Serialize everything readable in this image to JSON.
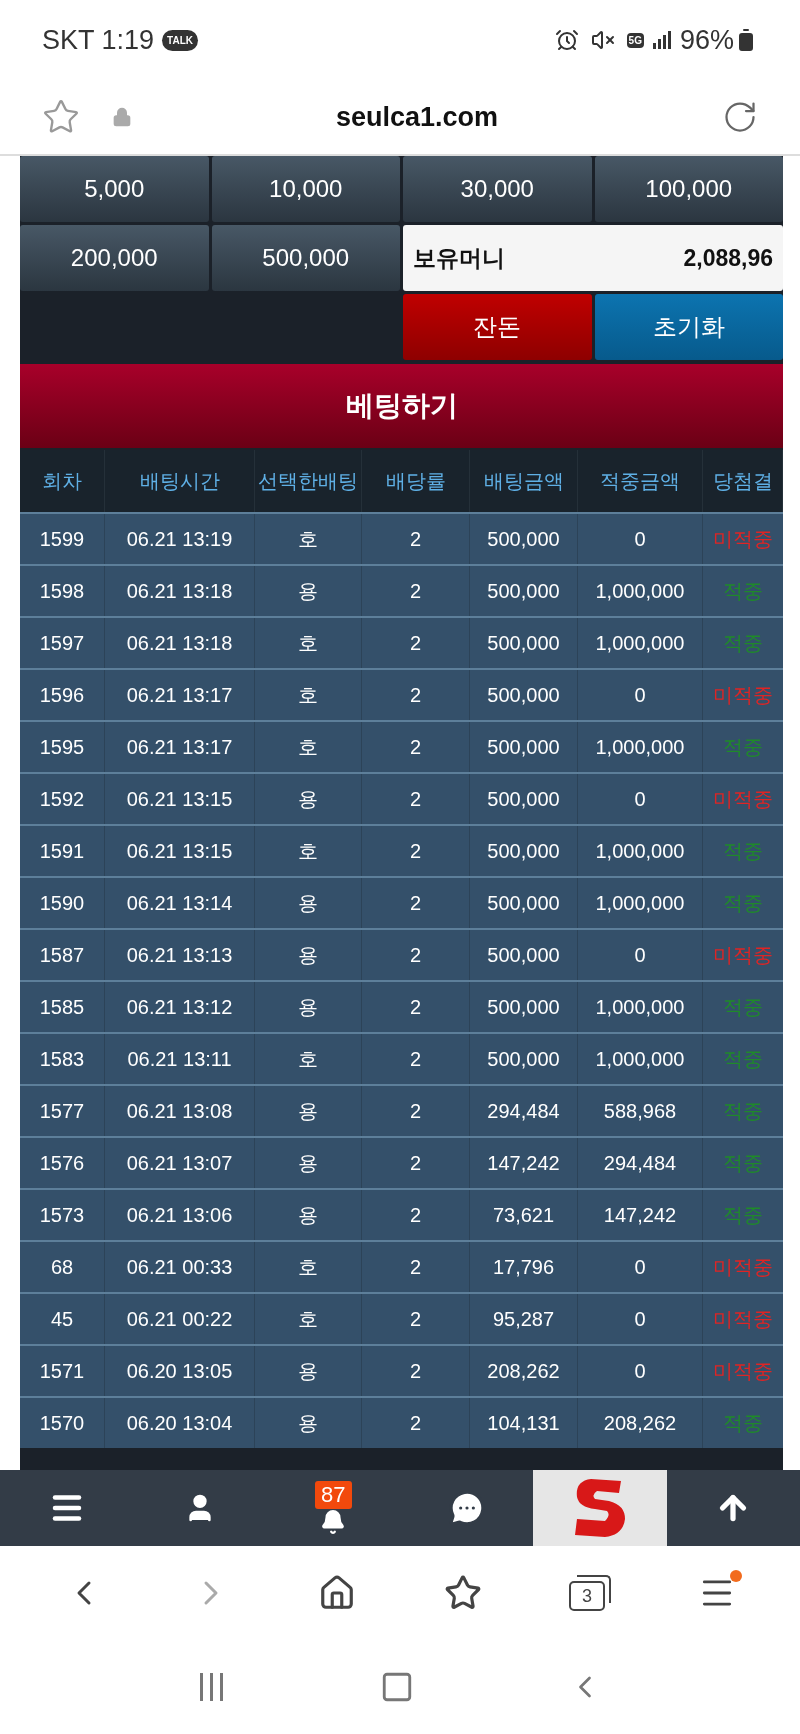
{
  "status_bar": {
    "carrier_time": "SKT 1:19",
    "chat_badge": "TALK",
    "network": "5G",
    "battery": "96%"
  },
  "address_bar": {
    "url": "seulca1.com"
  },
  "chip_buttons": [
    "5,000",
    "10,000",
    "30,000",
    "100,000",
    "200,000",
    "500,000"
  ],
  "balance": {
    "label": "보유머니",
    "value": "2,088,96"
  },
  "actions": [
    {
      "label": "잔돈",
      "kind": "change"
    },
    {
      "label": "초기화",
      "kind": "reset"
    }
  ],
  "bet_button": "베팅하기",
  "table": {
    "columns": [
      "회차",
      "배팅시간",
      "선택한배팅",
      "배당률",
      "배팅금액",
      "적중금액",
      "당첨결"
    ],
    "rows": [
      {
        "round": "1599",
        "time": "06.21 13:19",
        "pick": "호",
        "odds": "2",
        "amount": "500,000",
        "payout": "0",
        "result": "미적중",
        "won": false
      },
      {
        "round": "1598",
        "time": "06.21 13:18",
        "pick": "용",
        "odds": "2",
        "amount": "500,000",
        "payout": "1,000,000",
        "result": "적중",
        "won": true
      },
      {
        "round": "1597",
        "time": "06.21 13:18",
        "pick": "호",
        "odds": "2",
        "amount": "500,000",
        "payout": "1,000,000",
        "result": "적중",
        "won": true
      },
      {
        "round": "1596",
        "time": "06.21 13:17",
        "pick": "호",
        "odds": "2",
        "amount": "500,000",
        "payout": "0",
        "result": "미적중",
        "won": false
      },
      {
        "round": "1595",
        "time": "06.21 13:17",
        "pick": "호",
        "odds": "2",
        "amount": "500,000",
        "payout": "1,000,000",
        "result": "적중",
        "won": true
      },
      {
        "round": "1592",
        "time": "06.21 13:15",
        "pick": "용",
        "odds": "2",
        "amount": "500,000",
        "payout": "0",
        "result": "미적중",
        "won": false
      },
      {
        "round": "1591",
        "time": "06.21 13:15",
        "pick": "호",
        "odds": "2",
        "amount": "500,000",
        "payout": "1,000,000",
        "result": "적중",
        "won": true
      },
      {
        "round": "1590",
        "time": "06.21 13:14",
        "pick": "용",
        "odds": "2",
        "amount": "500,000",
        "payout": "1,000,000",
        "result": "적중",
        "won": true
      },
      {
        "round": "1587",
        "time": "06.21 13:13",
        "pick": "용",
        "odds": "2",
        "amount": "500,000",
        "payout": "0",
        "result": "미적중",
        "won": false
      },
      {
        "round": "1585",
        "time": "06.21 13:12",
        "pick": "용",
        "odds": "2",
        "amount": "500,000",
        "payout": "1,000,000",
        "result": "적중",
        "won": true
      },
      {
        "round": "1583",
        "time": "06.21 13:11",
        "pick": "호",
        "odds": "2",
        "amount": "500,000",
        "payout": "1,000,000",
        "result": "적중",
        "won": true
      },
      {
        "round": "1577",
        "time": "06.21 13:08",
        "pick": "용",
        "odds": "2",
        "amount": "294,484",
        "payout": "588,968",
        "result": "적중",
        "won": true
      },
      {
        "round": "1576",
        "time": "06.21 13:07",
        "pick": "용",
        "odds": "2",
        "amount": "147,242",
        "payout": "294,484",
        "result": "적중",
        "won": true
      },
      {
        "round": "1573",
        "time": "06.21 13:06",
        "pick": "용",
        "odds": "2",
        "amount": "73,621",
        "payout": "147,242",
        "result": "적중",
        "won": true
      },
      {
        "round": "68",
        "time": "06.21 00:33",
        "pick": "호",
        "odds": "2",
        "amount": "17,796",
        "payout": "0",
        "result": "미적중",
        "won": false
      },
      {
        "round": "45",
        "time": "06.21 00:22",
        "pick": "호",
        "odds": "2",
        "amount": "95,287",
        "payout": "0",
        "result": "미적중",
        "won": false
      },
      {
        "round": "1571",
        "time": "06.20 13:05",
        "pick": "용",
        "odds": "2",
        "amount": "208,262",
        "payout": "0",
        "result": "미적중",
        "won": false
      },
      {
        "round": "1570",
        "time": "06.20 13:04",
        "pick": "용",
        "odds": "2",
        "amount": "104,131",
        "payout": "208,262",
        "result": "적중",
        "won": true
      }
    ]
  },
  "bottom_nav": {
    "notification_count": "87"
  },
  "browser_toolbar": {
    "tab_count": "3"
  }
}
